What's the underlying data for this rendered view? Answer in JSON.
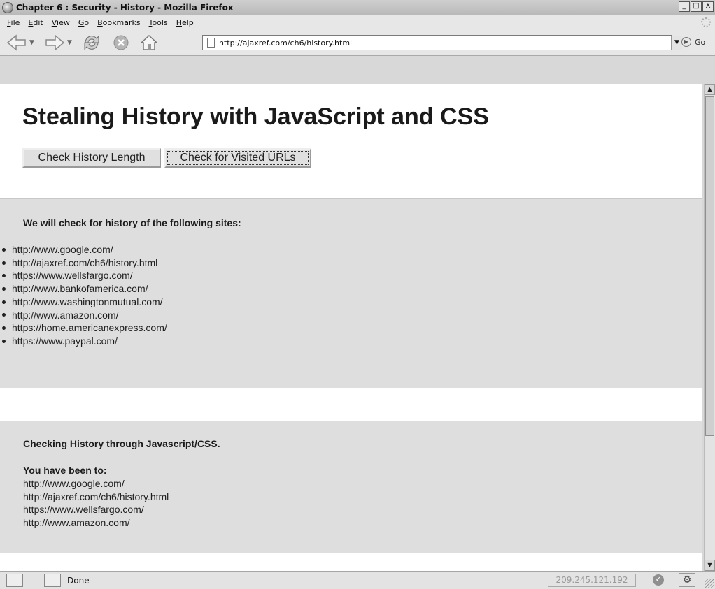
{
  "window": {
    "title": "Chapter 6 : Security - History - Mozilla Firefox",
    "controls": [
      "_",
      "□",
      "X"
    ]
  },
  "menu": [
    {
      "label": "File",
      "accel": "F",
      "rest": "ile"
    },
    {
      "label": "Edit",
      "accel": "E",
      "rest": "dit"
    },
    {
      "label": "View",
      "accel": "V",
      "rest": "iew"
    },
    {
      "label": "Go",
      "accel": "G",
      "rest": "o"
    },
    {
      "label": "Bookmarks",
      "accel": "B",
      "rest": "ookmarks"
    },
    {
      "label": "Tools",
      "accel": "T",
      "rest": "ools"
    },
    {
      "label": "Help",
      "accel": "H",
      "rest": "elp"
    }
  ],
  "toolbar": {
    "url": "http://ajaxref.com/ch6/history.html",
    "go_label": "Go"
  },
  "page": {
    "heading": "Stealing History with JavaScript and CSS",
    "buttons": {
      "history_length": "Check History Length",
      "visited_urls": "Check for Visited URLs"
    },
    "sites_title": "We will check for history of the following sites:",
    "sites": [
      "http://www.google.com/",
      "http://ajaxref.com/ch6/history.html",
      "https://www.wellsfargo.com/",
      "http://www.bankofamerica.com/",
      "http://www.washingtonmutual.com/",
      "http://www.amazon.com/",
      "https://home.americanexpress.com/",
      "https://www.paypal.com/"
    ],
    "result_title": "Checking History through Javascript/CSS.",
    "visited_heading": "You have been to:",
    "visited": [
      "http://www.google.com/",
      "http://ajaxref.com/ch6/history.html",
      "https://www.wellsfargo.com/",
      "http://www.amazon.com/"
    ]
  },
  "status": {
    "text": "Done",
    "ip": "209.245.121.192"
  },
  "icons": [
    "app-icon",
    "back-arrow-icon",
    "forward-arrow-icon",
    "reload-icon",
    "stop-icon",
    "home-icon",
    "page-icon",
    "go-icon",
    "checkmark-icon",
    "gear-icon"
  ]
}
